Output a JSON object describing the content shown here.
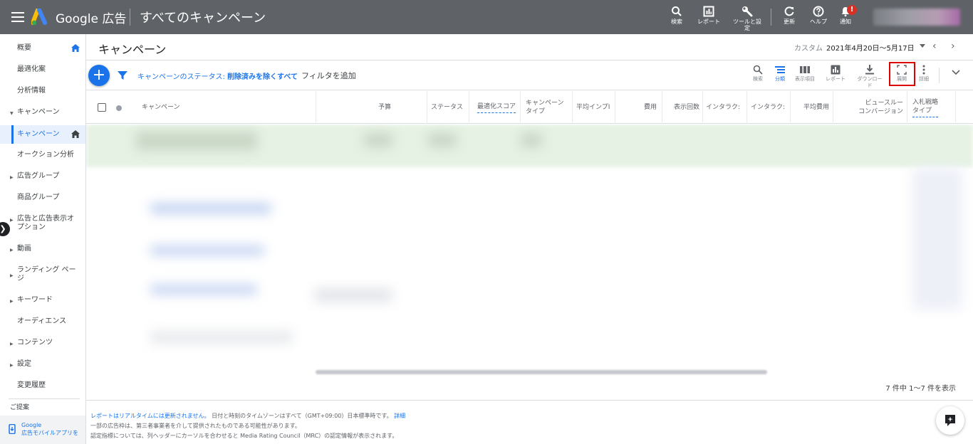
{
  "topbar": {
    "brand": "Google 広告",
    "title": "すべてのキャンペーン",
    "tools": [
      {
        "label": "検索",
        "icon": "search-icon"
      },
      {
        "label": "レポート",
        "icon": "report-icon"
      },
      {
        "label": "ツールと設定",
        "icon": "wrench-icon"
      },
      {
        "label": "更新",
        "icon": "refresh-icon"
      },
      {
        "label": "ヘルプ",
        "icon": "help-icon"
      },
      {
        "label": "通知",
        "icon": "bell-icon"
      }
    ],
    "notification_badge": "!"
  },
  "sidebar": {
    "items": [
      {
        "label": "概要",
        "caret": false,
        "active": false,
        "home": true
      },
      {
        "label": "最適化案",
        "caret": false,
        "active": false
      },
      {
        "label": "分析情報",
        "caret": false,
        "active": false
      },
      {
        "label": "キャンペーン",
        "caret": true,
        "active": false
      },
      {
        "label": "キャンペーン",
        "caret": false,
        "active": true,
        "home": true
      },
      {
        "label": "オークション分析",
        "caret": false,
        "active": false
      },
      {
        "label": "広告グループ",
        "caret": true,
        "active": false
      },
      {
        "label": "商品グループ",
        "caret": false,
        "active": false
      },
      {
        "label": "広告と広告表示オプション",
        "caret": true,
        "active": false
      },
      {
        "label": "動画",
        "caret": true,
        "active": false
      },
      {
        "label": "ランディング ページ",
        "caret": true,
        "active": false
      },
      {
        "label": "キーワード",
        "caret": true,
        "active": false
      },
      {
        "label": "オーディエンス",
        "caret": false,
        "active": false
      },
      {
        "label": "コンテンツ",
        "caret": true,
        "active": false
      },
      {
        "label": "設定",
        "caret": true,
        "active": false
      },
      {
        "label": "変更履歴",
        "caret": false,
        "active": false
      },
      {
        "label": "ご提案",
        "caret": false,
        "active": false
      }
    ],
    "mobile_app_line1": "Google",
    "mobile_app_line2": "広告モバイルアプリを"
  },
  "header": {
    "title": "キャンペーン",
    "date_label": "カスタム",
    "date_range": "2021年4月20日～5月17日"
  },
  "filter_bar": {
    "status_prefix": "キャンペーンのステータス: ",
    "status_value": "削除済みを除くすべて",
    "add_filter": "フィルタを追加",
    "tools": [
      {
        "label": "検索",
        "icon": "search-icon"
      },
      {
        "label": "分類",
        "icon": "segment-icon",
        "active": true
      },
      {
        "label": "表示項目",
        "icon": "columns-icon"
      },
      {
        "label": "レポート",
        "icon": "report-icon"
      },
      {
        "label": "ダウンロード",
        "icon": "download-icon"
      },
      {
        "label": "展開",
        "icon": "expand-icon"
      },
      {
        "label": "詳細",
        "icon": "more-icon"
      }
    ]
  },
  "table": {
    "columns": [
      {
        "label": "キャンペーン",
        "align": "left"
      },
      {
        "label": "予算",
        "align": "right"
      },
      {
        "label": "ステータス",
        "align": "left"
      },
      {
        "label": "最適化スコア",
        "align": "left",
        "dashed": true
      },
      {
        "label": "キャンペーン\nタイプ",
        "align": "left"
      },
      {
        "label": "平均インプI",
        "align": "left"
      },
      {
        "label": "費用",
        "align": "right"
      },
      {
        "label": "表示回数",
        "align": "right"
      },
      {
        "label": "インタラク:",
        "align": "left"
      },
      {
        "label": "インタラク:",
        "align": "left"
      },
      {
        "label": "平均費用",
        "align": "right"
      },
      {
        "label": "ビュースルー\nコンバージョン",
        "align": "right"
      },
      {
        "label": "入札戦略\nタイプ",
        "align": "left",
        "dashed": true
      }
    ],
    "pager": "7 件中 1～7 件を表示"
  },
  "footer": {
    "line1_link": "レポートはリアルタイムには更新されません。",
    "line1_text": " 日付と時刻のタイムゾーンはすべて（GMT+09:00）日本標準時です。",
    "line1_detail": "詳細",
    "line2": "一部の広告枠は、第三者事業者を介して提供されたものである可能性があります。",
    "line3": "認定指標については、列ヘッダーにカーソルを合わせると Media Rating Council（MRC）の認定情報が表示されます。"
  },
  "colors": {
    "topbar": "#5f6368",
    "accent": "#1a73e8",
    "highlight": "#e00000"
  }
}
